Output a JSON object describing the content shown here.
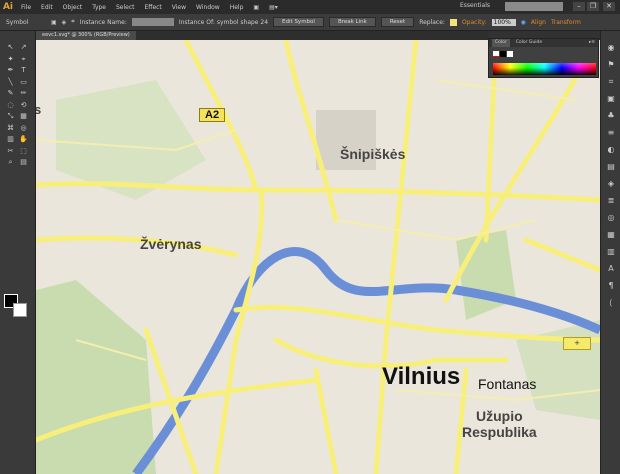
{
  "app": {
    "logo": "Ai",
    "menu": [
      "File",
      "Edit",
      "Object",
      "Type",
      "Select",
      "Effect",
      "View",
      "Window",
      "Help"
    ],
    "workspace": "Essentials",
    "window_buttons": [
      "minimize",
      "restore",
      "close"
    ]
  },
  "control": {
    "mode": "Symbol",
    "instance_name_label": "Instance Name:",
    "instance_name_value": "",
    "instance_of": "Instance Of: symbol shape 24",
    "edit_symbol": "Edit Symbol",
    "break_link": "Break Link",
    "reset": "Reset",
    "replace_label": "Replace:",
    "opacity_label": "Opacity:",
    "opacity_value": "100%",
    "align": "Align",
    "transform": "Transform"
  },
  "document": {
    "tab": "eevc1.svg* @ 300% (RGB/Preview)"
  },
  "color_panel": {
    "tabs": [
      "Color",
      "Color Guide"
    ]
  },
  "map": {
    "labels": {
      "a2": "A2",
      "snipiskes": "Šnipiškės",
      "zverynas": "Žvėrynas",
      "vilnius": "Vilnius",
      "fontanas": "Fontanas",
      "uzupio1": "Užupio",
      "uzupio2": "Respublika",
      "left_fragment": "s"
    },
    "selected_symbol": "+",
    "colors": {
      "land": "#ebe6dc",
      "road": "#f8ef7a",
      "river": "#6b8fd6",
      "park": "#c9dcb0"
    }
  }
}
